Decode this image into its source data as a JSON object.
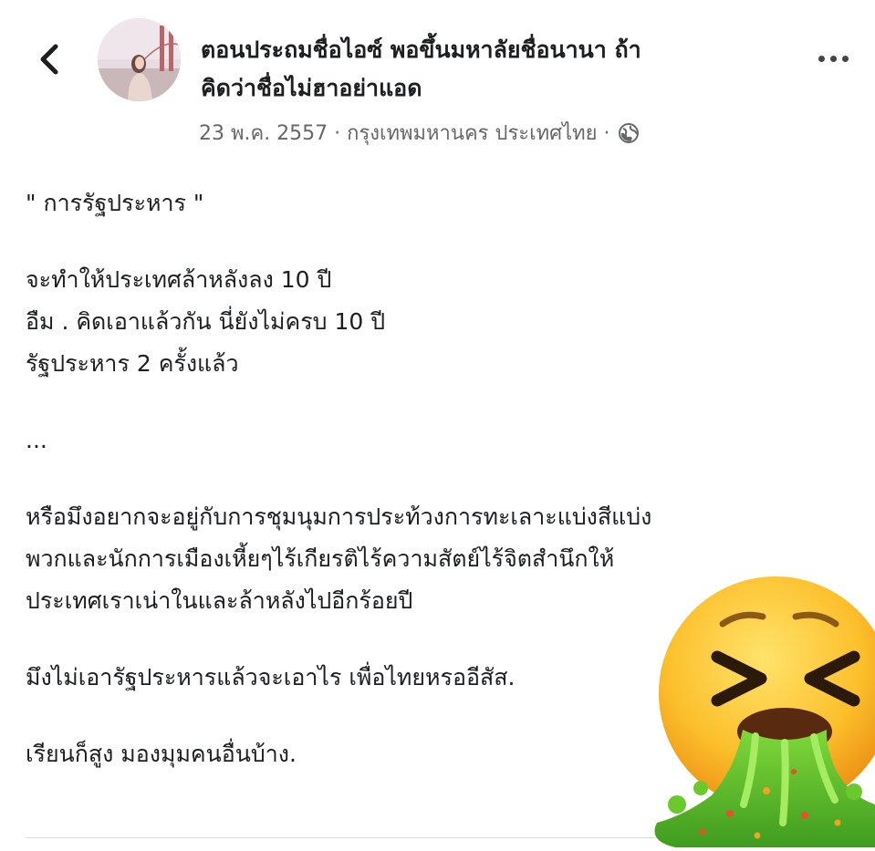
{
  "header": {
    "back_icon": "chevron-left-icon",
    "title": "ตอนประถมชื่อไอซ์ พอขึ้นมหาลัยชื่อนานา ถ้าคิดว่าชื่อไม่ฮาอย่าแอด",
    "title_line1": "ตอนประถมชื่อไอซ์ พอขึ้นมหาลัยชื่อนานา ถ้า",
    "title_line2": "คิดว่าชื่อไม่ฮาอย่าแอด",
    "meta": "23 พ.ค. 2557 · กรุงเทพมหานคร ประเทศไทย ·",
    "privacy_icon": "globe-icon",
    "more_icon": "more-horizontal-icon"
  },
  "post": {
    "line1": "\" การรัฐประหาร \"",
    "line2": "จะทำให้ประเทศล้าหลังลง 10 ปี",
    "line3": "อืม . คิดเอาแล้วกัน นี่ยังไม่ครบ 10 ปี",
    "line4": "รัฐประหาร 2 ครั้งแล้ว",
    "line5": "...",
    "line6": "หรือมึงอยากจะอยู่กับการชุมนุมการประท้วงการทะเลาะแบ่งสีแบ่ง",
    "line7": "พวกและนักการเมืองเหี้ยๆไร้เกียรติไร้ความสัตย์ไร้จิตสำนึกให้",
    "line8": "ประเทศเราเน่าในและล้าหลังไปอีกร้อยปี",
    "line9": "มึงไม่เอารัฐประหารแล้วจะเอาไร เพื่อไทยหรออีสัส.",
    "line10": "เรียนก็สูง มองมุมคนอื่นบ้าง."
  },
  "overlay": {
    "sticker_icon": "vomiting-face-emoji"
  },
  "colors": {
    "text": "#1c1e21",
    "meta": "#65676b",
    "background": "#ffffff"
  }
}
